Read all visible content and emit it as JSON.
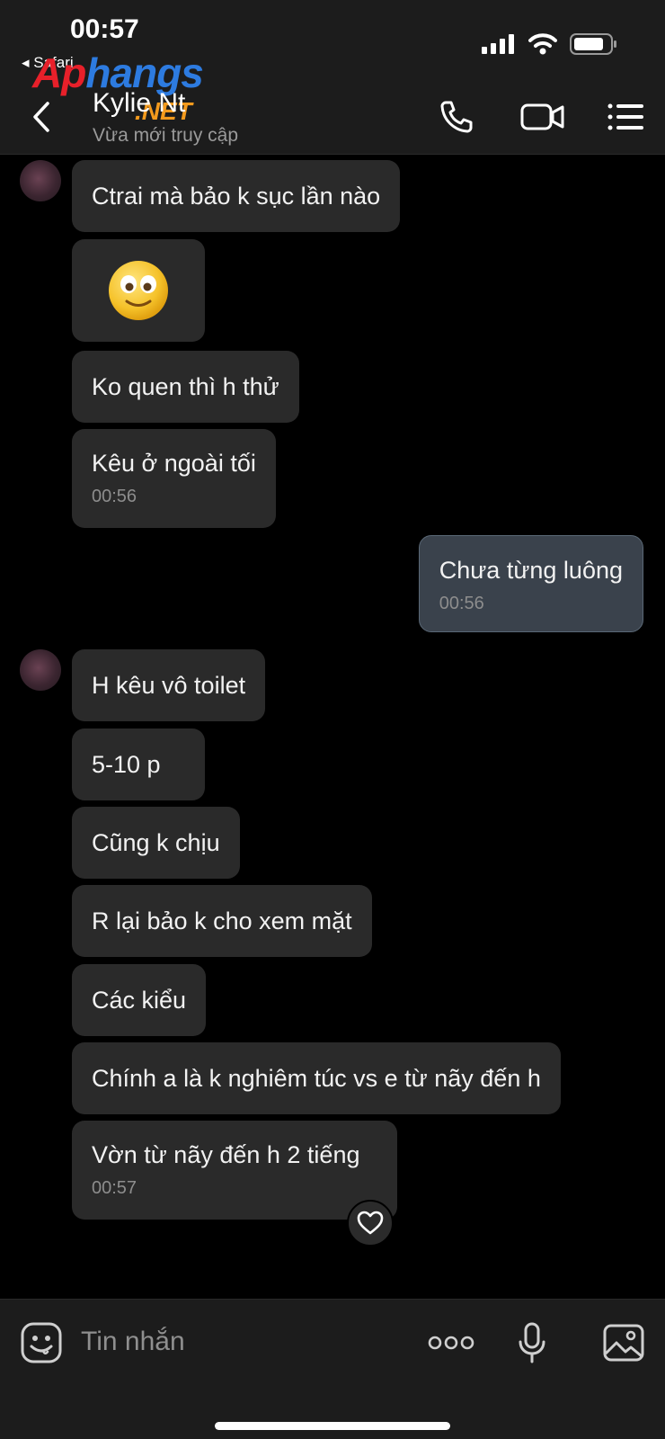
{
  "status_bar": {
    "time": "00:57",
    "back_app": "◂ Safari"
  },
  "watermark": {
    "part1": "Ap",
    "part2": "hangs",
    "part3": ".NET"
  },
  "header": {
    "contact_name": "Kylie Nt",
    "contact_status": "Vừa mới truy cập",
    "icons": [
      "back-chevron-icon",
      "phone-icon",
      "video-camera-icon",
      "menu-icon"
    ]
  },
  "messages": [
    {
      "side": "received",
      "text": "Ctrai mà bảo k sục lần nào"
    },
    {
      "side": "received",
      "text": "🙂",
      "type": "emoji"
    },
    {
      "side": "received",
      "text": "Ko quen thì h thử"
    },
    {
      "side": "received",
      "text": "Kêu ở ngoài tối",
      "time": "00:56"
    },
    {
      "side": "sent",
      "text": "Chưa từng luông",
      "time": "00:56"
    },
    {
      "side": "received",
      "text": "H kêu vô toilet"
    },
    {
      "side": "received",
      "text": "5-10 p"
    },
    {
      "side": "received",
      "text": "Cũng k chịu"
    },
    {
      "side": "received",
      "text": "R lại bảo k cho xem mặt"
    },
    {
      "side": "received",
      "text": "Các kiểu"
    },
    {
      "side": "received",
      "text": "Chính a là k nghiêm túc vs e từ nãy đến h"
    },
    {
      "side": "received",
      "text": "Vờn từ nãy đến h 2 tiếng",
      "time": "00:57"
    }
  ],
  "composer": {
    "placeholder": "Tin nhắn",
    "icons": [
      "emoji-icon",
      "more-dots-icon",
      "microphone-icon",
      "gallery-icon"
    ]
  },
  "colors": {
    "header_bg": "#1c1c1c",
    "received_bubble": "#2a2a2a",
    "sent_bubble": "#3a424c",
    "sent_border": "#5a6876"
  }
}
